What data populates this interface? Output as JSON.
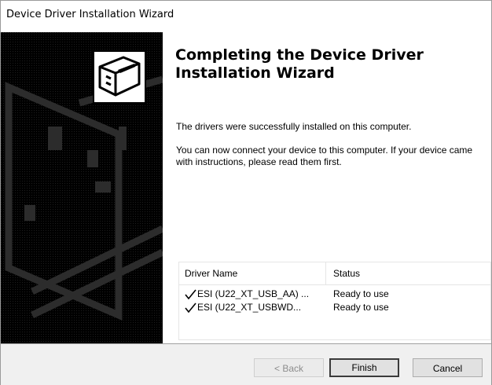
{
  "window": {
    "title": "Device Driver Installation Wizard"
  },
  "sidebar": {
    "icon": "hardware-install-icon"
  },
  "content": {
    "heading": "Completing the Device Driver Installation Wizard",
    "message1": "The drivers were successfully installed on this computer.",
    "message2": "You can now connect your device to this computer. If your device came with instructions, please read them first."
  },
  "driver_list": {
    "columns": [
      "Driver Name",
      "Status"
    ],
    "rows": [
      {
        "icon": "checkmark-icon",
        "name": "ESI (U22_XT_USB_AA) ...",
        "status": "Ready to use"
      },
      {
        "icon": "checkmark-icon",
        "name": "ESI (U22_XT_USBWD...",
        "status": "Ready to use"
      }
    ]
  },
  "buttons": {
    "back": "< Back",
    "finish": "Finish",
    "cancel": "Cancel"
  }
}
